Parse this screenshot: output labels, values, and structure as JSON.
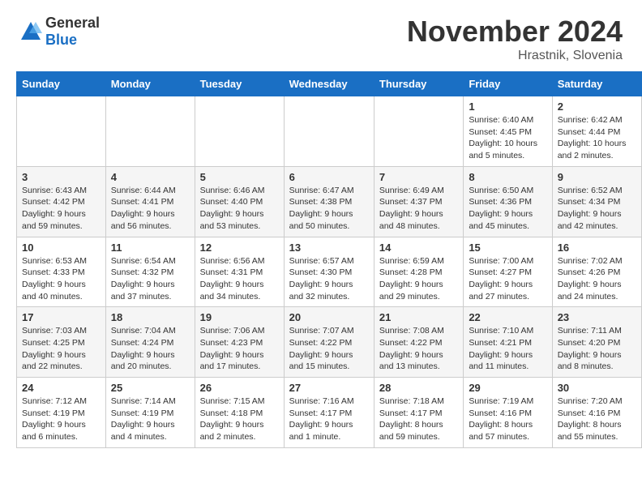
{
  "logo": {
    "general": "General",
    "blue": "Blue"
  },
  "title": "November 2024",
  "location": "Hrastnik, Slovenia",
  "weekdays": [
    "Sunday",
    "Monday",
    "Tuesday",
    "Wednesday",
    "Thursday",
    "Friday",
    "Saturday"
  ],
  "rows": [
    [
      {
        "day": "",
        "info": ""
      },
      {
        "day": "",
        "info": ""
      },
      {
        "day": "",
        "info": ""
      },
      {
        "day": "",
        "info": ""
      },
      {
        "day": "",
        "info": ""
      },
      {
        "day": "1",
        "info": "Sunrise: 6:40 AM\nSunset: 4:45 PM\nDaylight: 10 hours\nand 5 minutes."
      },
      {
        "day": "2",
        "info": "Sunrise: 6:42 AM\nSunset: 4:44 PM\nDaylight: 10 hours\nand 2 minutes."
      }
    ],
    [
      {
        "day": "3",
        "info": "Sunrise: 6:43 AM\nSunset: 4:42 PM\nDaylight: 9 hours\nand 59 minutes."
      },
      {
        "day": "4",
        "info": "Sunrise: 6:44 AM\nSunset: 4:41 PM\nDaylight: 9 hours\nand 56 minutes."
      },
      {
        "day": "5",
        "info": "Sunrise: 6:46 AM\nSunset: 4:40 PM\nDaylight: 9 hours\nand 53 minutes."
      },
      {
        "day": "6",
        "info": "Sunrise: 6:47 AM\nSunset: 4:38 PM\nDaylight: 9 hours\nand 50 minutes."
      },
      {
        "day": "7",
        "info": "Sunrise: 6:49 AM\nSunset: 4:37 PM\nDaylight: 9 hours\nand 48 minutes."
      },
      {
        "day": "8",
        "info": "Sunrise: 6:50 AM\nSunset: 4:36 PM\nDaylight: 9 hours\nand 45 minutes."
      },
      {
        "day": "9",
        "info": "Sunrise: 6:52 AM\nSunset: 4:34 PM\nDaylight: 9 hours\nand 42 minutes."
      }
    ],
    [
      {
        "day": "10",
        "info": "Sunrise: 6:53 AM\nSunset: 4:33 PM\nDaylight: 9 hours\nand 40 minutes."
      },
      {
        "day": "11",
        "info": "Sunrise: 6:54 AM\nSunset: 4:32 PM\nDaylight: 9 hours\nand 37 minutes."
      },
      {
        "day": "12",
        "info": "Sunrise: 6:56 AM\nSunset: 4:31 PM\nDaylight: 9 hours\nand 34 minutes."
      },
      {
        "day": "13",
        "info": "Sunrise: 6:57 AM\nSunset: 4:30 PM\nDaylight: 9 hours\nand 32 minutes."
      },
      {
        "day": "14",
        "info": "Sunrise: 6:59 AM\nSunset: 4:28 PM\nDaylight: 9 hours\nand 29 minutes."
      },
      {
        "day": "15",
        "info": "Sunrise: 7:00 AM\nSunset: 4:27 PM\nDaylight: 9 hours\nand 27 minutes."
      },
      {
        "day": "16",
        "info": "Sunrise: 7:02 AM\nSunset: 4:26 PM\nDaylight: 9 hours\nand 24 minutes."
      }
    ],
    [
      {
        "day": "17",
        "info": "Sunrise: 7:03 AM\nSunset: 4:25 PM\nDaylight: 9 hours\nand 22 minutes."
      },
      {
        "day": "18",
        "info": "Sunrise: 7:04 AM\nSunset: 4:24 PM\nDaylight: 9 hours\nand 20 minutes."
      },
      {
        "day": "19",
        "info": "Sunrise: 7:06 AM\nSunset: 4:23 PM\nDaylight: 9 hours\nand 17 minutes."
      },
      {
        "day": "20",
        "info": "Sunrise: 7:07 AM\nSunset: 4:22 PM\nDaylight: 9 hours\nand 15 minutes."
      },
      {
        "day": "21",
        "info": "Sunrise: 7:08 AM\nSunset: 4:22 PM\nDaylight: 9 hours\nand 13 minutes."
      },
      {
        "day": "22",
        "info": "Sunrise: 7:10 AM\nSunset: 4:21 PM\nDaylight: 9 hours\nand 11 minutes."
      },
      {
        "day": "23",
        "info": "Sunrise: 7:11 AM\nSunset: 4:20 PM\nDaylight: 9 hours\nand 8 minutes."
      }
    ],
    [
      {
        "day": "24",
        "info": "Sunrise: 7:12 AM\nSunset: 4:19 PM\nDaylight: 9 hours\nand 6 minutes."
      },
      {
        "day": "25",
        "info": "Sunrise: 7:14 AM\nSunset: 4:19 PM\nDaylight: 9 hours\nand 4 minutes."
      },
      {
        "day": "26",
        "info": "Sunrise: 7:15 AM\nSunset: 4:18 PM\nDaylight: 9 hours\nand 2 minutes."
      },
      {
        "day": "27",
        "info": "Sunrise: 7:16 AM\nSunset: 4:17 PM\nDaylight: 9 hours\nand 1 minute."
      },
      {
        "day": "28",
        "info": "Sunrise: 7:18 AM\nSunset: 4:17 PM\nDaylight: 8 hours\nand 59 minutes."
      },
      {
        "day": "29",
        "info": "Sunrise: 7:19 AM\nSunset: 4:16 PM\nDaylight: 8 hours\nand 57 minutes."
      },
      {
        "day": "30",
        "info": "Sunrise: 7:20 AM\nSunset: 4:16 PM\nDaylight: 8 hours\nand 55 minutes."
      }
    ]
  ]
}
